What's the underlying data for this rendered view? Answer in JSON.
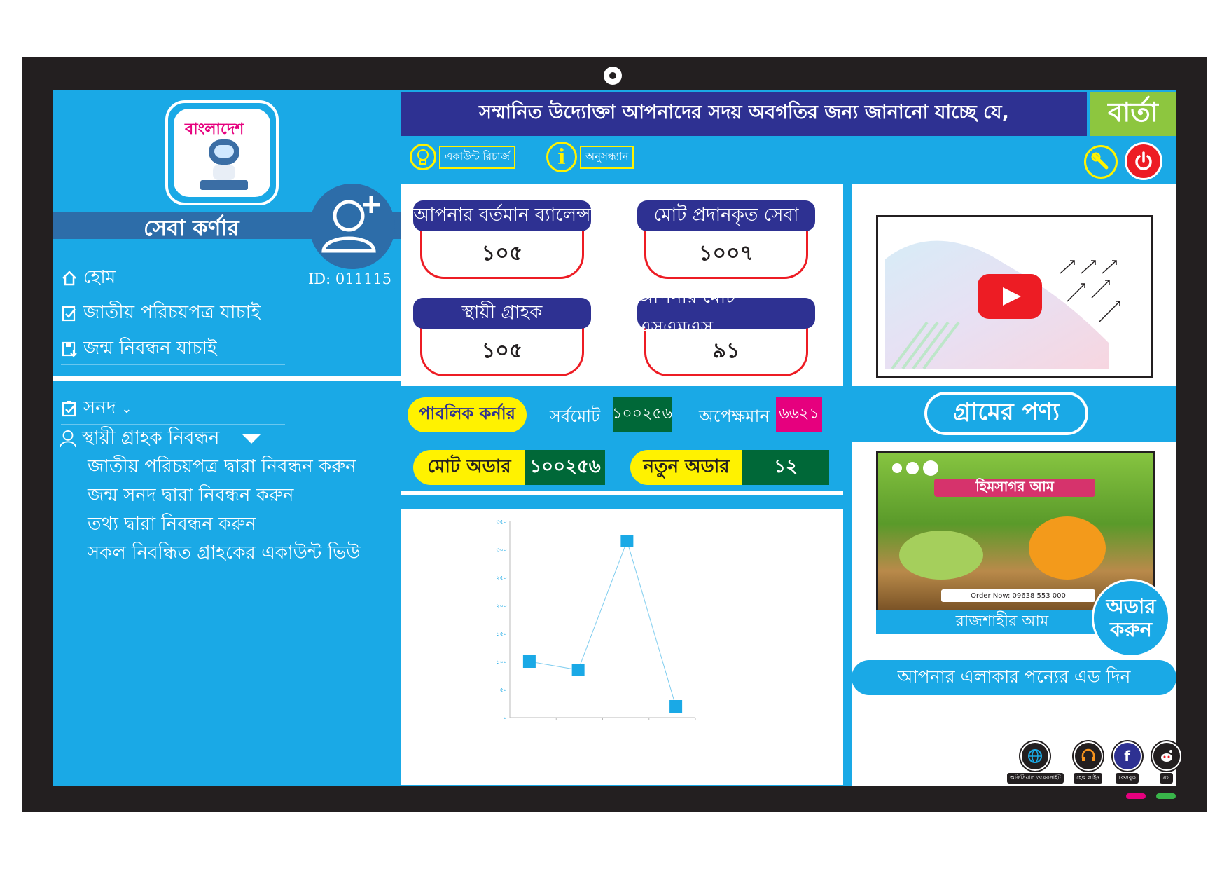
{
  "header": {
    "notice": "সম্মানিত উদ্যোক্তা আপনাদের সদয় অবগতির জন্য জানানো যাচ্ছে যে,",
    "barta": "বার্তা",
    "account_recharge": "একাউন্ট রিচার্জ",
    "inquiry": "অনুসন্ধ্যান"
  },
  "sidebar": {
    "logo_text": "বাংলাদেশ",
    "title": "সেবা কর্ণার",
    "user_id": "ID: 011115",
    "menu": [
      {
        "label": "হোম"
      },
      {
        "label": "জাতীয় পরিচয়পত্র যাচাই"
      },
      {
        "label": "জন্ম নিবন্ধন যাচাই"
      }
    ],
    "sanad": "সনদ",
    "registration": "স্থায়ী গ্রাহক নিবন্ধন",
    "sub_items": [
      {
        "label": "জাতীয় পরিচয়পত্র দ্বারা নিবন্ধন করুন"
      },
      {
        "label": "জন্ম সনদ দ্বারা নিবন্ধন করুন"
      },
      {
        "label": "তথ্য দ্বারা নিবন্ধন করুন"
      },
      {
        "label": "সকল নিবন্ধিত গ্রাহকের একাউন্ট ভিউ"
      }
    ]
  },
  "stats": [
    {
      "label": "আপনার বর্তমান ব্যালেন্স",
      "value": "১০৫"
    },
    {
      "label": "মোট প্রদানকৃত সেবা",
      "value": "১০০৭"
    },
    {
      "label": "স্থায়ী গ্রাহক",
      "value": "১০৫"
    },
    {
      "label": "আপনার মোট এসএমএস",
      "value": "৯১"
    }
  ],
  "public_corner": {
    "label": "পাবলিক কর্নার",
    "total_label": "সর্বমোট",
    "total_value": "১০০২৫৬",
    "waiting_label": "অপেক্ষমান",
    "waiting_value": "৬৬২১"
  },
  "orders": {
    "total_label": "মোট অডার",
    "total_value": "১০০২৫৬",
    "new_label": "নতুন অডার",
    "new_value": "১২"
  },
  "products": {
    "title": "গ্রামের পণ্য",
    "image_title": "হিমসাগর আম",
    "order_now_text": "Order Now: 09638 553 000",
    "caption": "রাজশাহীর আম",
    "order_button": [
      "অডার",
      "করুন"
    ],
    "ad_button": "আপনার এলাকার পন্যের এড দিন"
  },
  "social": [
    {
      "icon": "globe-icon",
      "label": "অফিসিয়াল ওয়েবসাইট"
    },
    {
      "icon": "headset-icon",
      "label": "হেল্প লাইন"
    },
    {
      "icon": "facebook-icon",
      "label": "ফেসবুক"
    },
    {
      "icon": "reddit-icon",
      "label": "ব্লগ"
    }
  ],
  "colors": {
    "primary": "#1aa9e6",
    "navy": "#2e3192",
    "accent_green": "#8dc63f",
    "dark_green": "#006838",
    "yellow": "#fff200",
    "red": "#ed1c24",
    "pink": "#e6007e",
    "frame": "#231f20"
  },
  "chart_data": {
    "type": "line",
    "x": [
      1,
      2,
      3,
      4
    ],
    "values": [
      100,
      85,
      315,
      20
    ],
    "y_ticks": [
      "০",
      "৫০",
      "১০০",
      "১৫০",
      "২০০",
      "২৫০",
      "৩০০",
      "৩৫০"
    ],
    "ylim": [
      0,
      350
    ],
    "grid": false,
    "marker_color": "#1aa9e6"
  }
}
